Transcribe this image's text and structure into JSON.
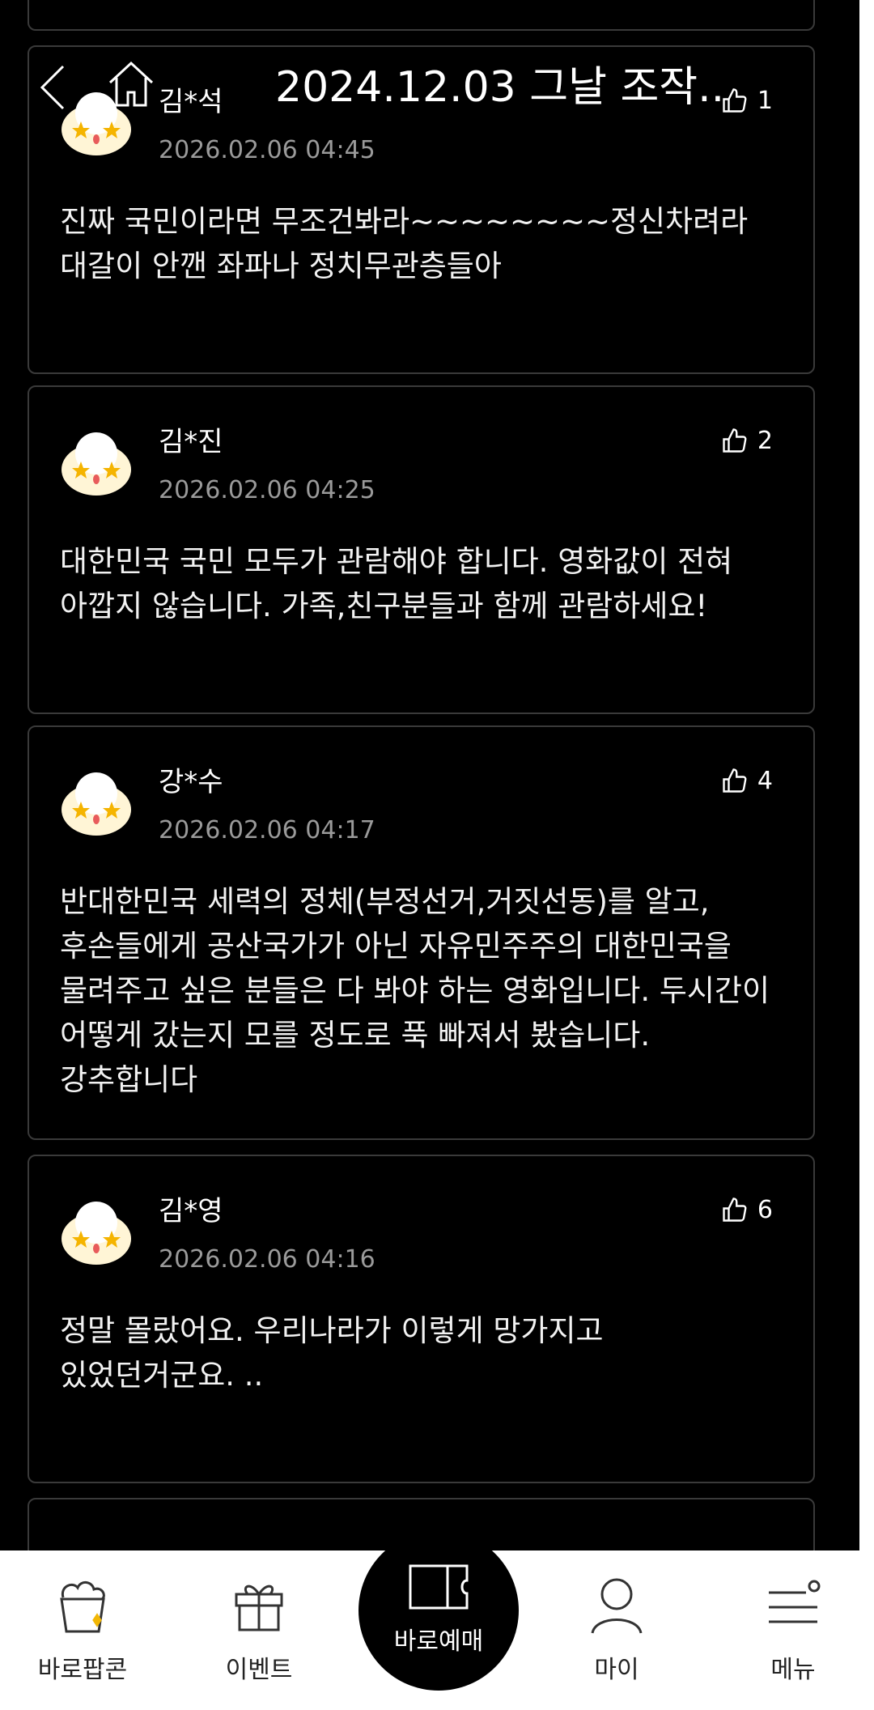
{
  "header": {
    "back_icon": "chevron-left-icon",
    "home_icon": "home-icon",
    "title": "2024.12.03 그날 조작.."
  },
  "reviews": [
    {
      "name": "김*석",
      "date": "2026.02.06 04:45",
      "likes": "1",
      "body": "진짜 국민이라면 무조건봐라~~~~~~~~정신차려라 대갈이 안깬 좌파나 정치무관층들아"
    },
    {
      "name": "김*진",
      "date": "2026.02.06 04:25",
      "likes": "2",
      "body": "대한민국 국민 모두가 관람해야 합니다. 영화값이 전혀 아깝지 않습니다. 가족,친구분들과 함께 관람하세요!"
    },
    {
      "name": "강*수",
      "date": "2026.02.06 04:17",
      "likes": "4",
      "body": "반대한민국 세력의 정체(부정선거,거짓선동)를 알고, 후손들에게 공산국가가 아닌 자유민주주의 대한민국을 물려주고 싶은 분들은 다 봐야 하는 영화입니다. 두시간이 어떻게 갔는지 모를 정도로 푹 빠져서 봤습니다.강추합니다"
    },
    {
      "name": "김*영",
      "date": "2026.02.06 04:16",
      "likes": "6",
      "body": "정말 몰랐어요. 우리나라가 이렇게 망가지고 있었던거군요. .."
    }
  ],
  "nav": {
    "popcorn": "바로팝콘",
    "event": "이벤트",
    "booking": "바로예매",
    "my": "마이",
    "menu": "메뉴"
  },
  "colors": {
    "accent": "#f2b705",
    "background": "#000000",
    "nav_background": "#ffffff"
  }
}
